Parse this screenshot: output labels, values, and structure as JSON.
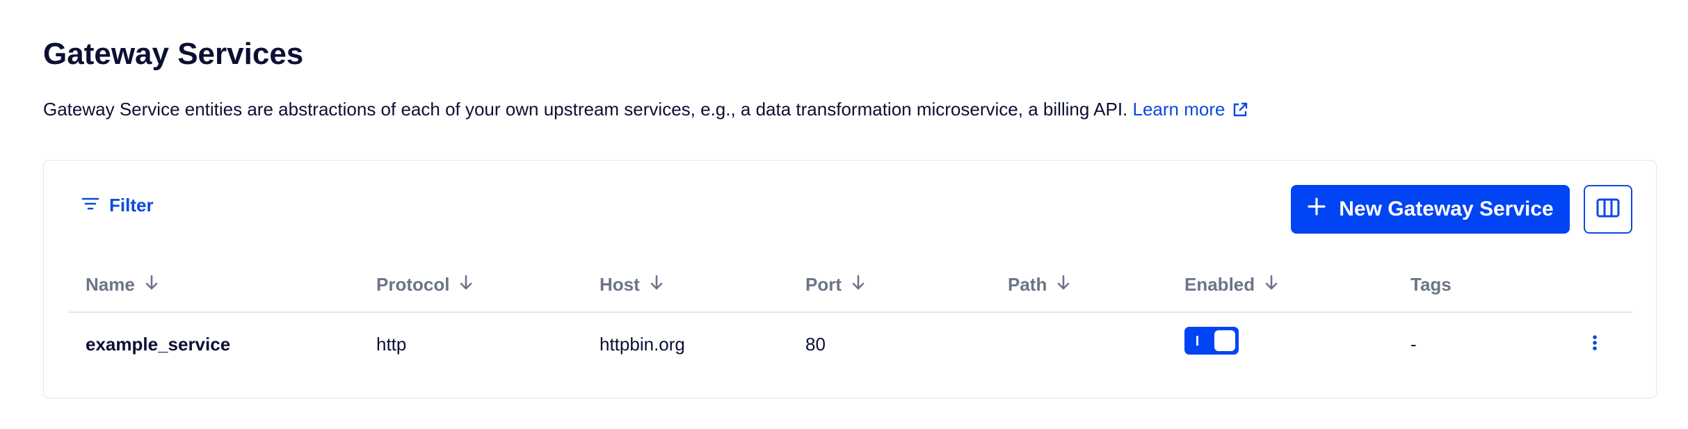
{
  "page": {
    "title": "Gateway Services",
    "description": "Gateway Service entities are abstractions of each of your own upstream services, e.g., a data transformation microservice, a billing API.",
    "learn_more_label": "Learn more"
  },
  "toolbar": {
    "filter_label": "Filter",
    "new_service_label": "New Gateway Service",
    "filter_icon": "filter-icon",
    "plus_icon": "plus-icon",
    "columns_icon": "columns-icon"
  },
  "table": {
    "columns": [
      {
        "label": "Name",
        "sortable": true
      },
      {
        "label": "Protocol",
        "sortable": true
      },
      {
        "label": "Host",
        "sortable": true
      },
      {
        "label": "Port",
        "sortable": true
      },
      {
        "label": "Path",
        "sortable": true
      },
      {
        "label": "Enabled",
        "sortable": true
      },
      {
        "label": "Tags",
        "sortable": false
      }
    ],
    "rows": [
      {
        "name": "example_service",
        "protocol": "http",
        "host": "httpbin.org",
        "port": "80",
        "path": "",
        "enabled": true,
        "tags": "-"
      }
    ]
  },
  "colors": {
    "accent": "#0044f4",
    "link": "#0b48e3",
    "text": "#0b1033",
    "muted": "#6c7489",
    "border": "#e2e5ec"
  }
}
